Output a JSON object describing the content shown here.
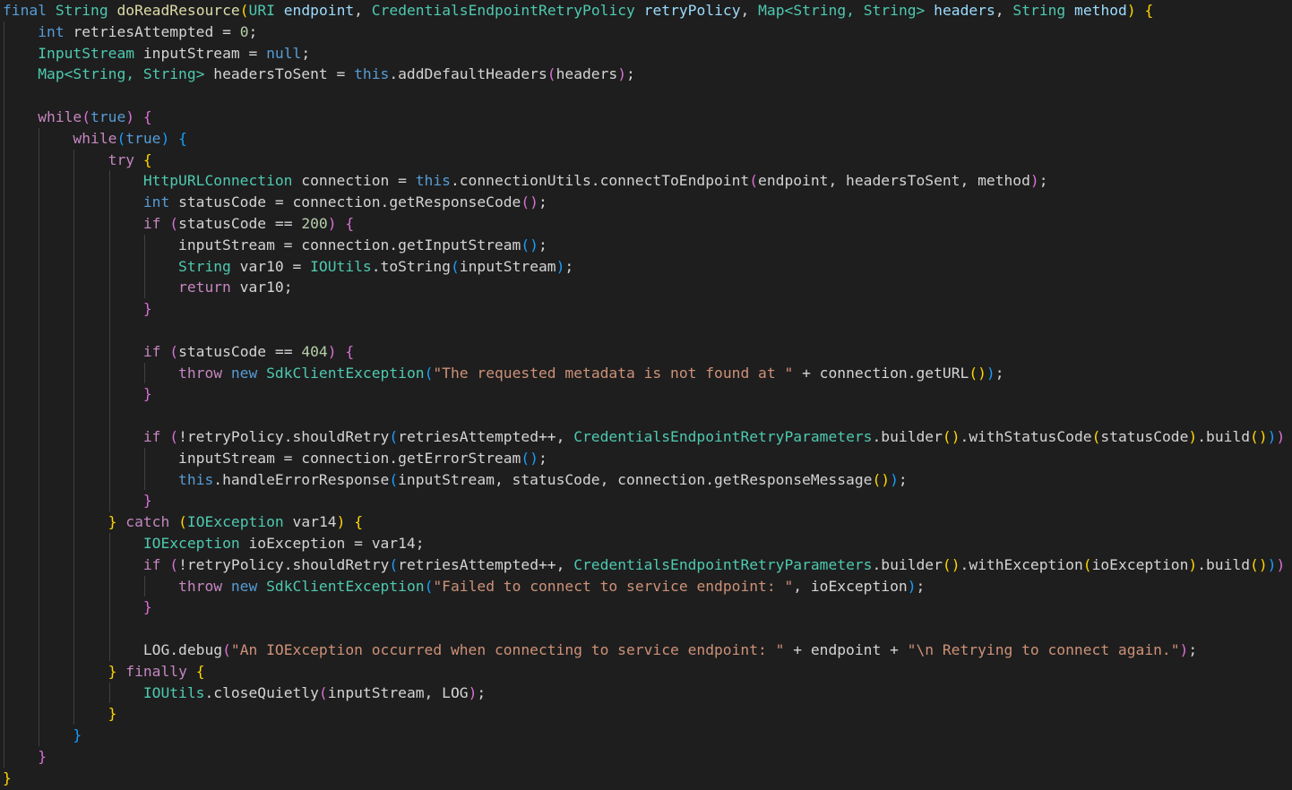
{
  "colors": {
    "background": "#1e1e1e",
    "kw": "#569cd6",
    "ctrl": "#c586c0",
    "type": "#4ec9b0",
    "fn": "#dcdcaa",
    "var": "#9cdcfe",
    "str": "#ce9178",
    "num": "#b5cea8",
    "plain": "#d4d4d4",
    "b1": "#ffd700",
    "b2": "#da70d6",
    "b3": "#179fff",
    "indent_guide": "#404040"
  },
  "code": {
    "language": "java",
    "lines": [
      [
        [
          "final",
          "kw"
        ],
        [
          " ",
          "plain"
        ],
        [
          "String",
          "type"
        ],
        [
          " ",
          "plain"
        ],
        [
          "doReadResource",
          "fn"
        ],
        [
          "(",
          "b1"
        ],
        [
          "URI",
          "type"
        ],
        [
          " ",
          "plain"
        ],
        [
          "endpoint",
          "var"
        ],
        [
          ", ",
          "plain"
        ],
        [
          "CredentialsEndpointRetryPolicy",
          "type"
        ],
        [
          " ",
          "plain"
        ],
        [
          "retryPolicy",
          "var"
        ],
        [
          ", ",
          "plain"
        ],
        [
          "Map<String, String>",
          "type"
        ],
        [
          " ",
          "plain"
        ],
        [
          "headers",
          "var"
        ],
        [
          ", ",
          "plain"
        ],
        [
          "String",
          "type"
        ],
        [
          " ",
          "plain"
        ],
        [
          "method",
          "var"
        ],
        [
          ")",
          "b1"
        ],
        [
          " ",
          "plain"
        ],
        [
          "{",
          "b1"
        ]
      ],
      [
        [
          "    ",
          "plain"
        ],
        [
          "int",
          "kw"
        ],
        [
          " retriesAttempted = ",
          "plain"
        ],
        [
          "0",
          "num"
        ],
        [
          ";",
          "plain"
        ]
      ],
      [
        [
          "    ",
          "plain"
        ],
        [
          "InputStream",
          "type"
        ],
        [
          " inputStream = ",
          "plain"
        ],
        [
          "null",
          "kw"
        ],
        [
          ";",
          "plain"
        ]
      ],
      [
        [
          "    ",
          "plain"
        ],
        [
          "Map<String, String>",
          "type"
        ],
        [
          " headersToSent = ",
          "plain"
        ],
        [
          "this",
          "kw"
        ],
        [
          ".addDefaultHeaders",
          "plain"
        ],
        [
          "(",
          "b2"
        ],
        [
          "headers",
          "plain"
        ],
        [
          ")",
          "b2"
        ],
        [
          ";",
          "plain"
        ]
      ],
      [],
      [
        [
          "    ",
          "plain"
        ],
        [
          "while",
          "ctrl"
        ],
        [
          "(",
          "b2"
        ],
        [
          "true",
          "kw"
        ],
        [
          ")",
          "b2"
        ],
        [
          " ",
          "plain"
        ],
        [
          "{",
          "b2"
        ]
      ],
      [
        [
          "        ",
          "plain"
        ],
        [
          "while",
          "ctrl"
        ],
        [
          "(",
          "b3"
        ],
        [
          "true",
          "kw"
        ],
        [
          ")",
          "b3"
        ],
        [
          " ",
          "plain"
        ],
        [
          "{",
          "b3"
        ]
      ],
      [
        [
          "            ",
          "plain"
        ],
        [
          "try",
          "ctrl"
        ],
        [
          " ",
          "plain"
        ],
        [
          "{",
          "b1"
        ]
      ],
      [
        [
          "                ",
          "plain"
        ],
        [
          "HttpURLConnection",
          "type"
        ],
        [
          " connection = ",
          "plain"
        ],
        [
          "this",
          "kw"
        ],
        [
          ".connectionUtils.connectToEndpoint",
          "plain"
        ],
        [
          "(",
          "b2"
        ],
        [
          "endpoint, headersToSent, method",
          "plain"
        ],
        [
          ")",
          "b2"
        ],
        [
          ";",
          "plain"
        ]
      ],
      [
        [
          "                ",
          "plain"
        ],
        [
          "int",
          "kw"
        ],
        [
          " statusCode = connection.getResponseCode",
          "plain"
        ],
        [
          "()",
          "b2"
        ],
        [
          ";",
          "plain"
        ]
      ],
      [
        [
          "                ",
          "plain"
        ],
        [
          "if",
          "ctrl"
        ],
        [
          " ",
          "plain"
        ],
        [
          "(",
          "b2"
        ],
        [
          "statusCode == ",
          "plain"
        ],
        [
          "200",
          "num"
        ],
        [
          ")",
          "b2"
        ],
        [
          " ",
          "plain"
        ],
        [
          "{",
          "b2"
        ]
      ],
      [
        [
          "                    ",
          "plain"
        ],
        [
          "inputStream = connection.getInputStream",
          "plain"
        ],
        [
          "()",
          "b3"
        ],
        [
          ";",
          "plain"
        ]
      ],
      [
        [
          "                    ",
          "plain"
        ],
        [
          "String",
          "type"
        ],
        [
          " var10 = ",
          "plain"
        ],
        [
          "IOUtils",
          "type"
        ],
        [
          ".toString",
          "plain"
        ],
        [
          "(",
          "b3"
        ],
        [
          "inputStream",
          "plain"
        ],
        [
          ")",
          "b3"
        ],
        [
          ";",
          "plain"
        ]
      ],
      [
        [
          "                    ",
          "plain"
        ],
        [
          "return",
          "ctrl"
        ],
        [
          " var10;",
          "plain"
        ]
      ],
      [
        [
          "                ",
          "plain"
        ],
        [
          "}",
          "b2"
        ]
      ],
      [],
      [
        [
          "                ",
          "plain"
        ],
        [
          "if",
          "ctrl"
        ],
        [
          " ",
          "plain"
        ],
        [
          "(",
          "b2"
        ],
        [
          "statusCode == ",
          "plain"
        ],
        [
          "404",
          "num"
        ],
        [
          ")",
          "b2"
        ],
        [
          " ",
          "plain"
        ],
        [
          "{",
          "b2"
        ]
      ],
      [
        [
          "                    ",
          "plain"
        ],
        [
          "throw",
          "ctrl"
        ],
        [
          " ",
          "plain"
        ],
        [
          "new",
          "kw"
        ],
        [
          " ",
          "plain"
        ],
        [
          "SdkClientException",
          "type"
        ],
        [
          "(",
          "b3"
        ],
        [
          "\"The requested metadata is not found at \"",
          "str"
        ],
        [
          " + connection.getURL",
          "plain"
        ],
        [
          "()",
          "b1"
        ],
        [
          ")",
          "b3"
        ],
        [
          ";",
          "plain"
        ]
      ],
      [
        [
          "                ",
          "plain"
        ],
        [
          "}",
          "b2"
        ]
      ],
      [],
      [
        [
          "                ",
          "plain"
        ],
        [
          "if",
          "ctrl"
        ],
        [
          " ",
          "plain"
        ],
        [
          "(",
          "b2"
        ],
        [
          "!retryPolicy.shouldRetry",
          "plain"
        ],
        [
          "(",
          "b3"
        ],
        [
          "retriesAttempted++, ",
          "plain"
        ],
        [
          "CredentialsEndpointRetryParameters",
          "type"
        ],
        [
          ".builder",
          "plain"
        ],
        [
          "()",
          "b1"
        ],
        [
          ".withStatusCode",
          "plain"
        ],
        [
          "(",
          "b1"
        ],
        [
          "statusCode",
          "plain"
        ],
        [
          ")",
          "b1"
        ],
        [
          ".build",
          "plain"
        ],
        [
          "()",
          "b1"
        ],
        [
          ")",
          "b3"
        ],
        [
          ")",
          "b2"
        ],
        [
          " ",
          "plain"
        ],
        [
          "{",
          "b2"
        ]
      ],
      [
        [
          "                    ",
          "plain"
        ],
        [
          "inputStream = connection.getErrorStream",
          "plain"
        ],
        [
          "()",
          "b3"
        ],
        [
          ";",
          "plain"
        ]
      ],
      [
        [
          "                    ",
          "plain"
        ],
        [
          "this",
          "kw"
        ],
        [
          ".handleErrorResponse",
          "plain"
        ],
        [
          "(",
          "b3"
        ],
        [
          "inputStream, statusCode, connection.getResponseMessage",
          "plain"
        ],
        [
          "()",
          "b1"
        ],
        [
          ")",
          "b3"
        ],
        [
          ";",
          "plain"
        ]
      ],
      [
        [
          "                ",
          "plain"
        ],
        [
          "}",
          "b2"
        ]
      ],
      [
        [
          "            ",
          "plain"
        ],
        [
          "}",
          "b1"
        ],
        [
          " ",
          "plain"
        ],
        [
          "catch",
          "ctrl"
        ],
        [
          " ",
          "plain"
        ],
        [
          "(",
          "b1"
        ],
        [
          "IOException",
          "type"
        ],
        [
          " var14",
          "plain"
        ],
        [
          ")",
          "b1"
        ],
        [
          " ",
          "plain"
        ],
        [
          "{",
          "b1"
        ]
      ],
      [
        [
          "                ",
          "plain"
        ],
        [
          "IOException",
          "type"
        ],
        [
          " ioException = var14;",
          "plain"
        ]
      ],
      [
        [
          "                ",
          "plain"
        ],
        [
          "if",
          "ctrl"
        ],
        [
          " ",
          "plain"
        ],
        [
          "(",
          "b2"
        ],
        [
          "!retryPolicy.shouldRetry",
          "plain"
        ],
        [
          "(",
          "b3"
        ],
        [
          "retriesAttempted++, ",
          "plain"
        ],
        [
          "CredentialsEndpointRetryParameters",
          "type"
        ],
        [
          ".builder",
          "plain"
        ],
        [
          "()",
          "b1"
        ],
        [
          ".withException",
          "plain"
        ],
        [
          "(",
          "b1"
        ],
        [
          "ioException",
          "plain"
        ],
        [
          ")",
          "b1"
        ],
        [
          ".build",
          "plain"
        ],
        [
          "()",
          "b1"
        ],
        [
          ")",
          "b3"
        ],
        [
          ")",
          "b2"
        ],
        [
          " ",
          "plain"
        ],
        [
          "{",
          "b2"
        ]
      ],
      [
        [
          "                    ",
          "plain"
        ],
        [
          "throw",
          "ctrl"
        ],
        [
          " ",
          "plain"
        ],
        [
          "new",
          "kw"
        ],
        [
          " ",
          "plain"
        ],
        [
          "SdkClientException",
          "type"
        ],
        [
          "(",
          "b3"
        ],
        [
          "\"Failed to connect to service endpoint: \"",
          "str"
        ],
        [
          ", ioException",
          "plain"
        ],
        [
          ")",
          "b3"
        ],
        [
          ";",
          "plain"
        ]
      ],
      [
        [
          "                ",
          "plain"
        ],
        [
          "}",
          "b2"
        ]
      ],
      [],
      [
        [
          "                ",
          "plain"
        ],
        [
          "LOG.debug",
          "plain"
        ],
        [
          "(",
          "b2"
        ],
        [
          "\"An IOException occurred when connecting to service endpoint: \"",
          "str"
        ],
        [
          " + endpoint + ",
          "plain"
        ],
        [
          "\"\\n Retrying to connect again.\"",
          "str"
        ],
        [
          ")",
          "b2"
        ],
        [
          ";",
          "plain"
        ]
      ],
      [
        [
          "            ",
          "plain"
        ],
        [
          "}",
          "b1"
        ],
        [
          " ",
          "plain"
        ],
        [
          "finally",
          "ctrl"
        ],
        [
          " ",
          "plain"
        ],
        [
          "{",
          "b1"
        ]
      ],
      [
        [
          "                ",
          "plain"
        ],
        [
          "IOUtils",
          "type"
        ],
        [
          ".closeQuietly",
          "plain"
        ],
        [
          "(",
          "b2"
        ],
        [
          "inputStream, LOG",
          "plain"
        ],
        [
          ")",
          "b2"
        ],
        [
          ";",
          "plain"
        ]
      ],
      [
        [
          "            ",
          "plain"
        ],
        [
          "}",
          "b1"
        ]
      ],
      [
        [
          "        ",
          "plain"
        ],
        [
          "}",
          "b3"
        ]
      ],
      [
        [
          "    ",
          "plain"
        ],
        [
          "}",
          "b2"
        ]
      ],
      [
        [
          "}",
          "b1"
        ]
      ]
    ]
  }
}
